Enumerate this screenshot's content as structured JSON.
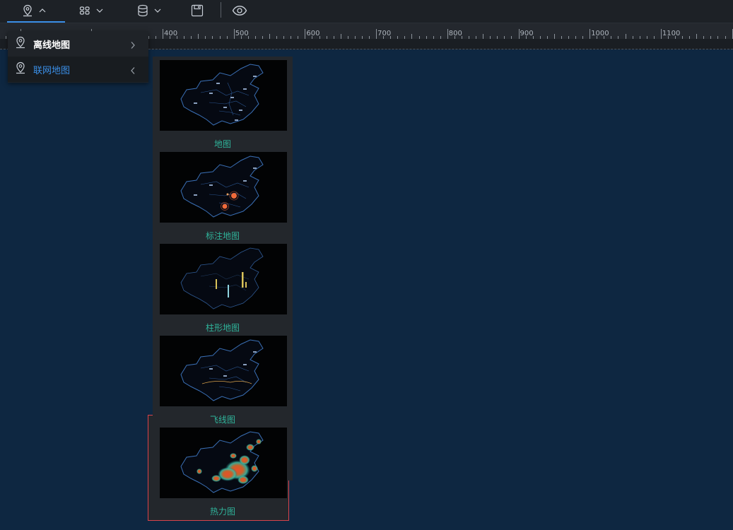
{
  "toolbar": {
    "buttons": [
      {
        "name": "map-pin-icon",
        "expanded": true
      },
      {
        "name": "component-grid-icon",
        "expanded": false
      },
      {
        "name": "database-icon",
        "expanded": false
      },
      {
        "name": "save-icon"
      },
      {
        "name": "eye-icon"
      }
    ],
    "accent": "#3a8ee6"
  },
  "ruler": {
    "labels": [
      "400",
      "500",
      "600",
      "700",
      "800",
      "900",
      "1000",
      "1100"
    ]
  },
  "menu": {
    "items": [
      {
        "label": "离线地图",
        "arrow": "chevron-right-icon",
        "color": "#ffffff"
      },
      {
        "label": "联网地图",
        "arrow": "chevron-left-icon",
        "color": "#3a8ee6"
      }
    ]
  },
  "gallery": {
    "items": [
      {
        "label": "地图",
        "thumb": "china-outline-map"
      },
      {
        "label": "标注地图",
        "thumb": "china-marker-map"
      },
      {
        "label": "柱形地图",
        "thumb": "china-bar-map"
      },
      {
        "label": "飞线图",
        "thumb": "china-flyline-map"
      },
      {
        "label": "热力图",
        "thumb": "china-heat-map",
        "selected": true
      }
    ],
    "label_color": "#2fb39a",
    "selected_border": "#d9434b"
  }
}
